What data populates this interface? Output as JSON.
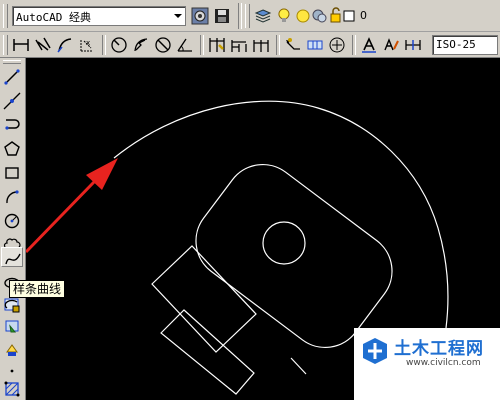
{
  "toolbar_top": {
    "workspace": "AutoCAD 经典",
    "layer_name": "0"
  },
  "toolbar_dim": {
    "dim_style": "ISO-25"
  },
  "draw_toolbar": {
    "tools": [
      "line-icon",
      "construction-line-icon",
      "polyline-icon",
      "polygon-icon",
      "rectangle-icon",
      "arc-icon",
      "circle-icon",
      "revision-cloud-icon",
      "spline-icon",
      "ellipse-icon",
      "ellipse-arc-icon",
      "insert-block-icon",
      "make-block-icon",
      "point-icon",
      "hatch-icon"
    ],
    "tooltip": "样条曲线"
  },
  "watermark": {
    "site_name": "土木工程网",
    "site_url": "www.civilcn.com"
  },
  "colors": {
    "toolbar_bg": "#d4d0c8",
    "canvas_bg": "#000000",
    "drawing_lines": "#ffffff",
    "arrow": "#e8231f",
    "tooltip_bg": "#ffffe1",
    "logo_blue": "#1f6fd1"
  }
}
